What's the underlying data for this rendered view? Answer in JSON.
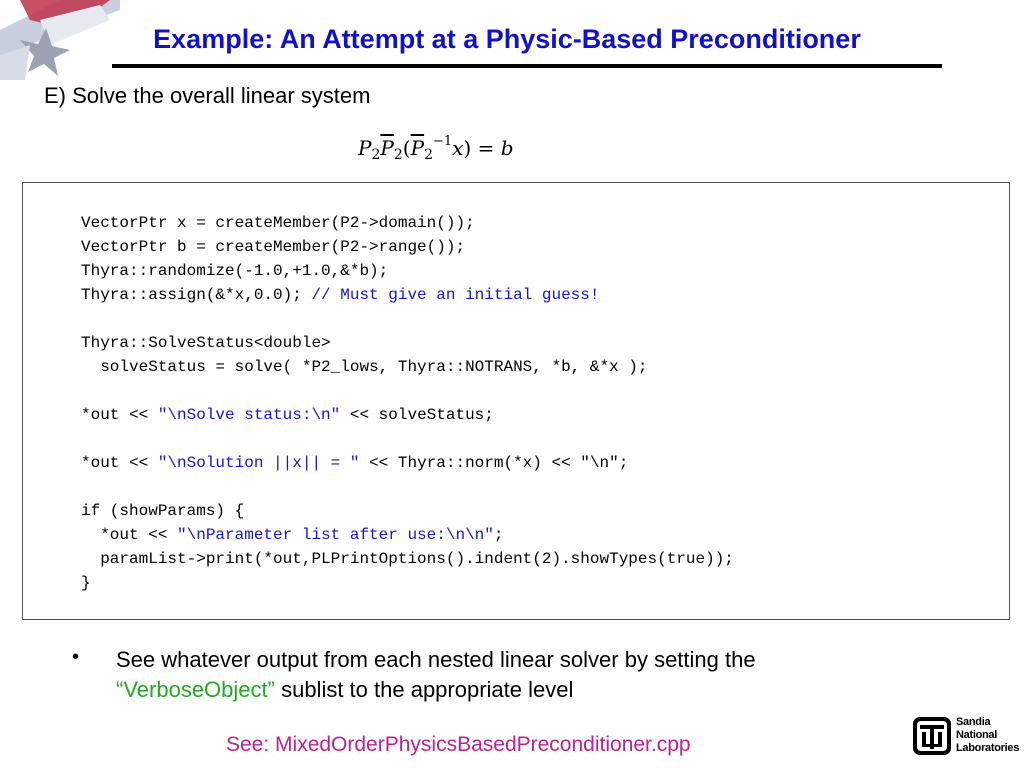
{
  "header": {
    "title": "Example: An Attempt at a Physic-Based Preconditioner"
  },
  "subtitle": "E) Solve the overall linear system",
  "equation": {
    "P": "P",
    "sub2": "2",
    "lparen": "(",
    "inv": "−1",
    "x": "x",
    "rparen_eq": ") = ",
    "b": "b"
  },
  "code": {
    "line1": "VectorPtr x = createMember(P2->domain());",
    "line2": "VectorPtr b = createMember(P2->range());",
    "line3": "Thyra::randomize(-1.0,+1.0,&*b);",
    "line4_code": "Thyra::assign(&*x,0.0); ",
    "line4_comment": "// Must give an initial guess!",
    "line5": "Thyra::SolveStatus<double>",
    "line6": "  solveStatus = solve( *P2_lows, Thyra::NOTRANS, *b, &*x );",
    "line7_pre": "*out << ",
    "line7_str": "\"\\nSolve status:\\n\"",
    "line7_post": " << solveStatus;",
    "line8_pre": "*out << ",
    "line8_str": "\"\\nSolution ||x|| = \"",
    "line8_post": " << Thyra::norm(*x) << \"\\n\";",
    "line9": "if (showParams) {",
    "line10_pre": "  *out << ",
    "line10_str": "\"\\nParameter list after use:\\n\\n\"",
    "line10_post": ";",
    "line11": "  paramList->print(*out,PLPrintOptions().indent(2).showTypes(true));",
    "line12": "}"
  },
  "bullet": {
    "marker": "•",
    "text_pre": "See whatever output from each nested linear solver by setting the ",
    "highlight": "“VerboseObject”",
    "text_post": " sublist to the appropriate level"
  },
  "footer": {
    "see_ref": "See: MixedOrderPhysicsBasedPreconditioner.cpp",
    "sandia_line1": "Sandia",
    "sandia_line2": "National",
    "sandia_line3": "Laboratories"
  },
  "colors": {
    "title": "#1111cc",
    "comment": "#1515cc",
    "highlight": "#22aa22",
    "reference": "#c0208f"
  }
}
